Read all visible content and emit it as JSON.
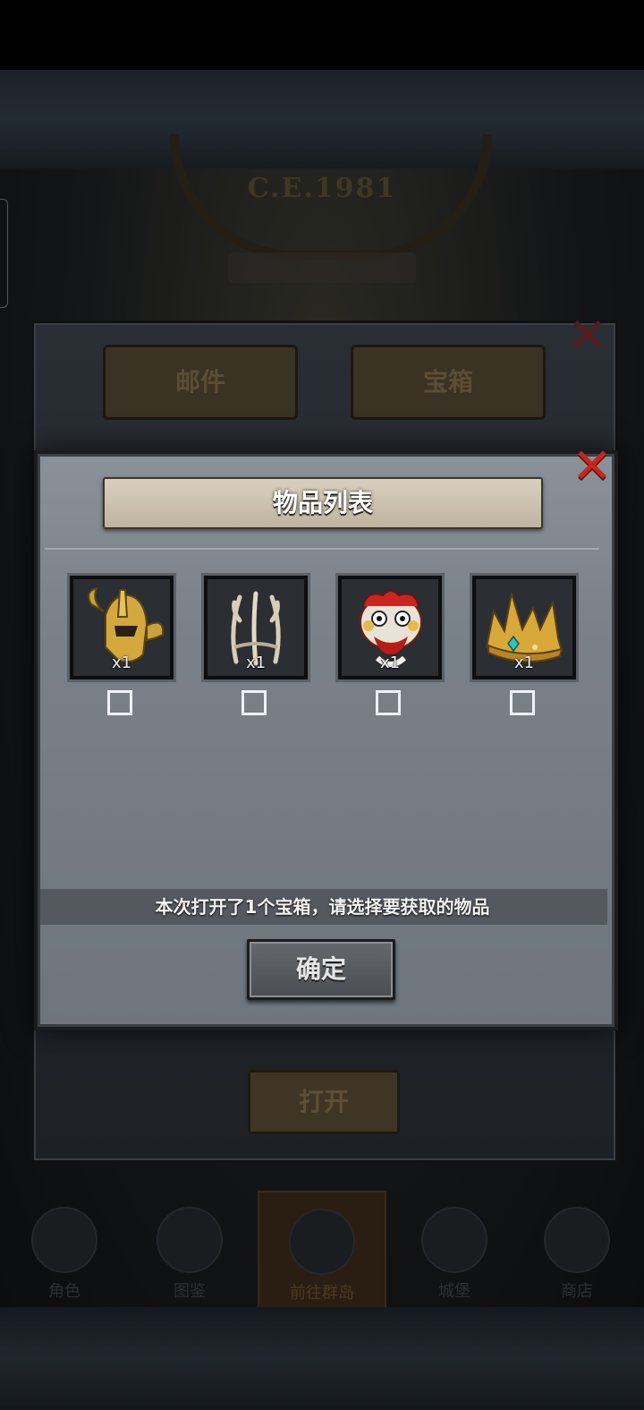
{
  "background": {
    "emblem_text": "C.E.1981",
    "outer_panel": {
      "tabs": [
        {
          "label": "邮件"
        },
        {
          "label": "宝箱"
        }
      ],
      "open_button_label": "打开"
    },
    "bottom_nav": [
      {
        "label": "角色",
        "active": false
      },
      {
        "label": "图鉴",
        "active": false
      },
      {
        "label": "前往群岛",
        "active": true
      },
      {
        "label": "城堡",
        "active": false
      },
      {
        "label": "商店",
        "active": false
      }
    ]
  },
  "modal": {
    "title": "物品列表",
    "items": [
      {
        "icon": "golden-horned-helmet-icon",
        "count": "x1",
        "checked": false
      },
      {
        "icon": "bone-antler-crown-icon",
        "count": "x1",
        "checked": false
      },
      {
        "icon": "lion-dance-mask-icon",
        "count": "x1",
        "checked": false
      },
      {
        "icon": "gold-jeweled-crown-icon",
        "count": "x1",
        "checked": false
      }
    ],
    "hint": "本次打开了1个宝箱，请选择要获取的物品",
    "confirm_label": "确定"
  },
  "colors": {
    "close_red": "#c8261f",
    "modal_gray": "#7a8189",
    "title_parchment": "#d8cfbf"
  }
}
